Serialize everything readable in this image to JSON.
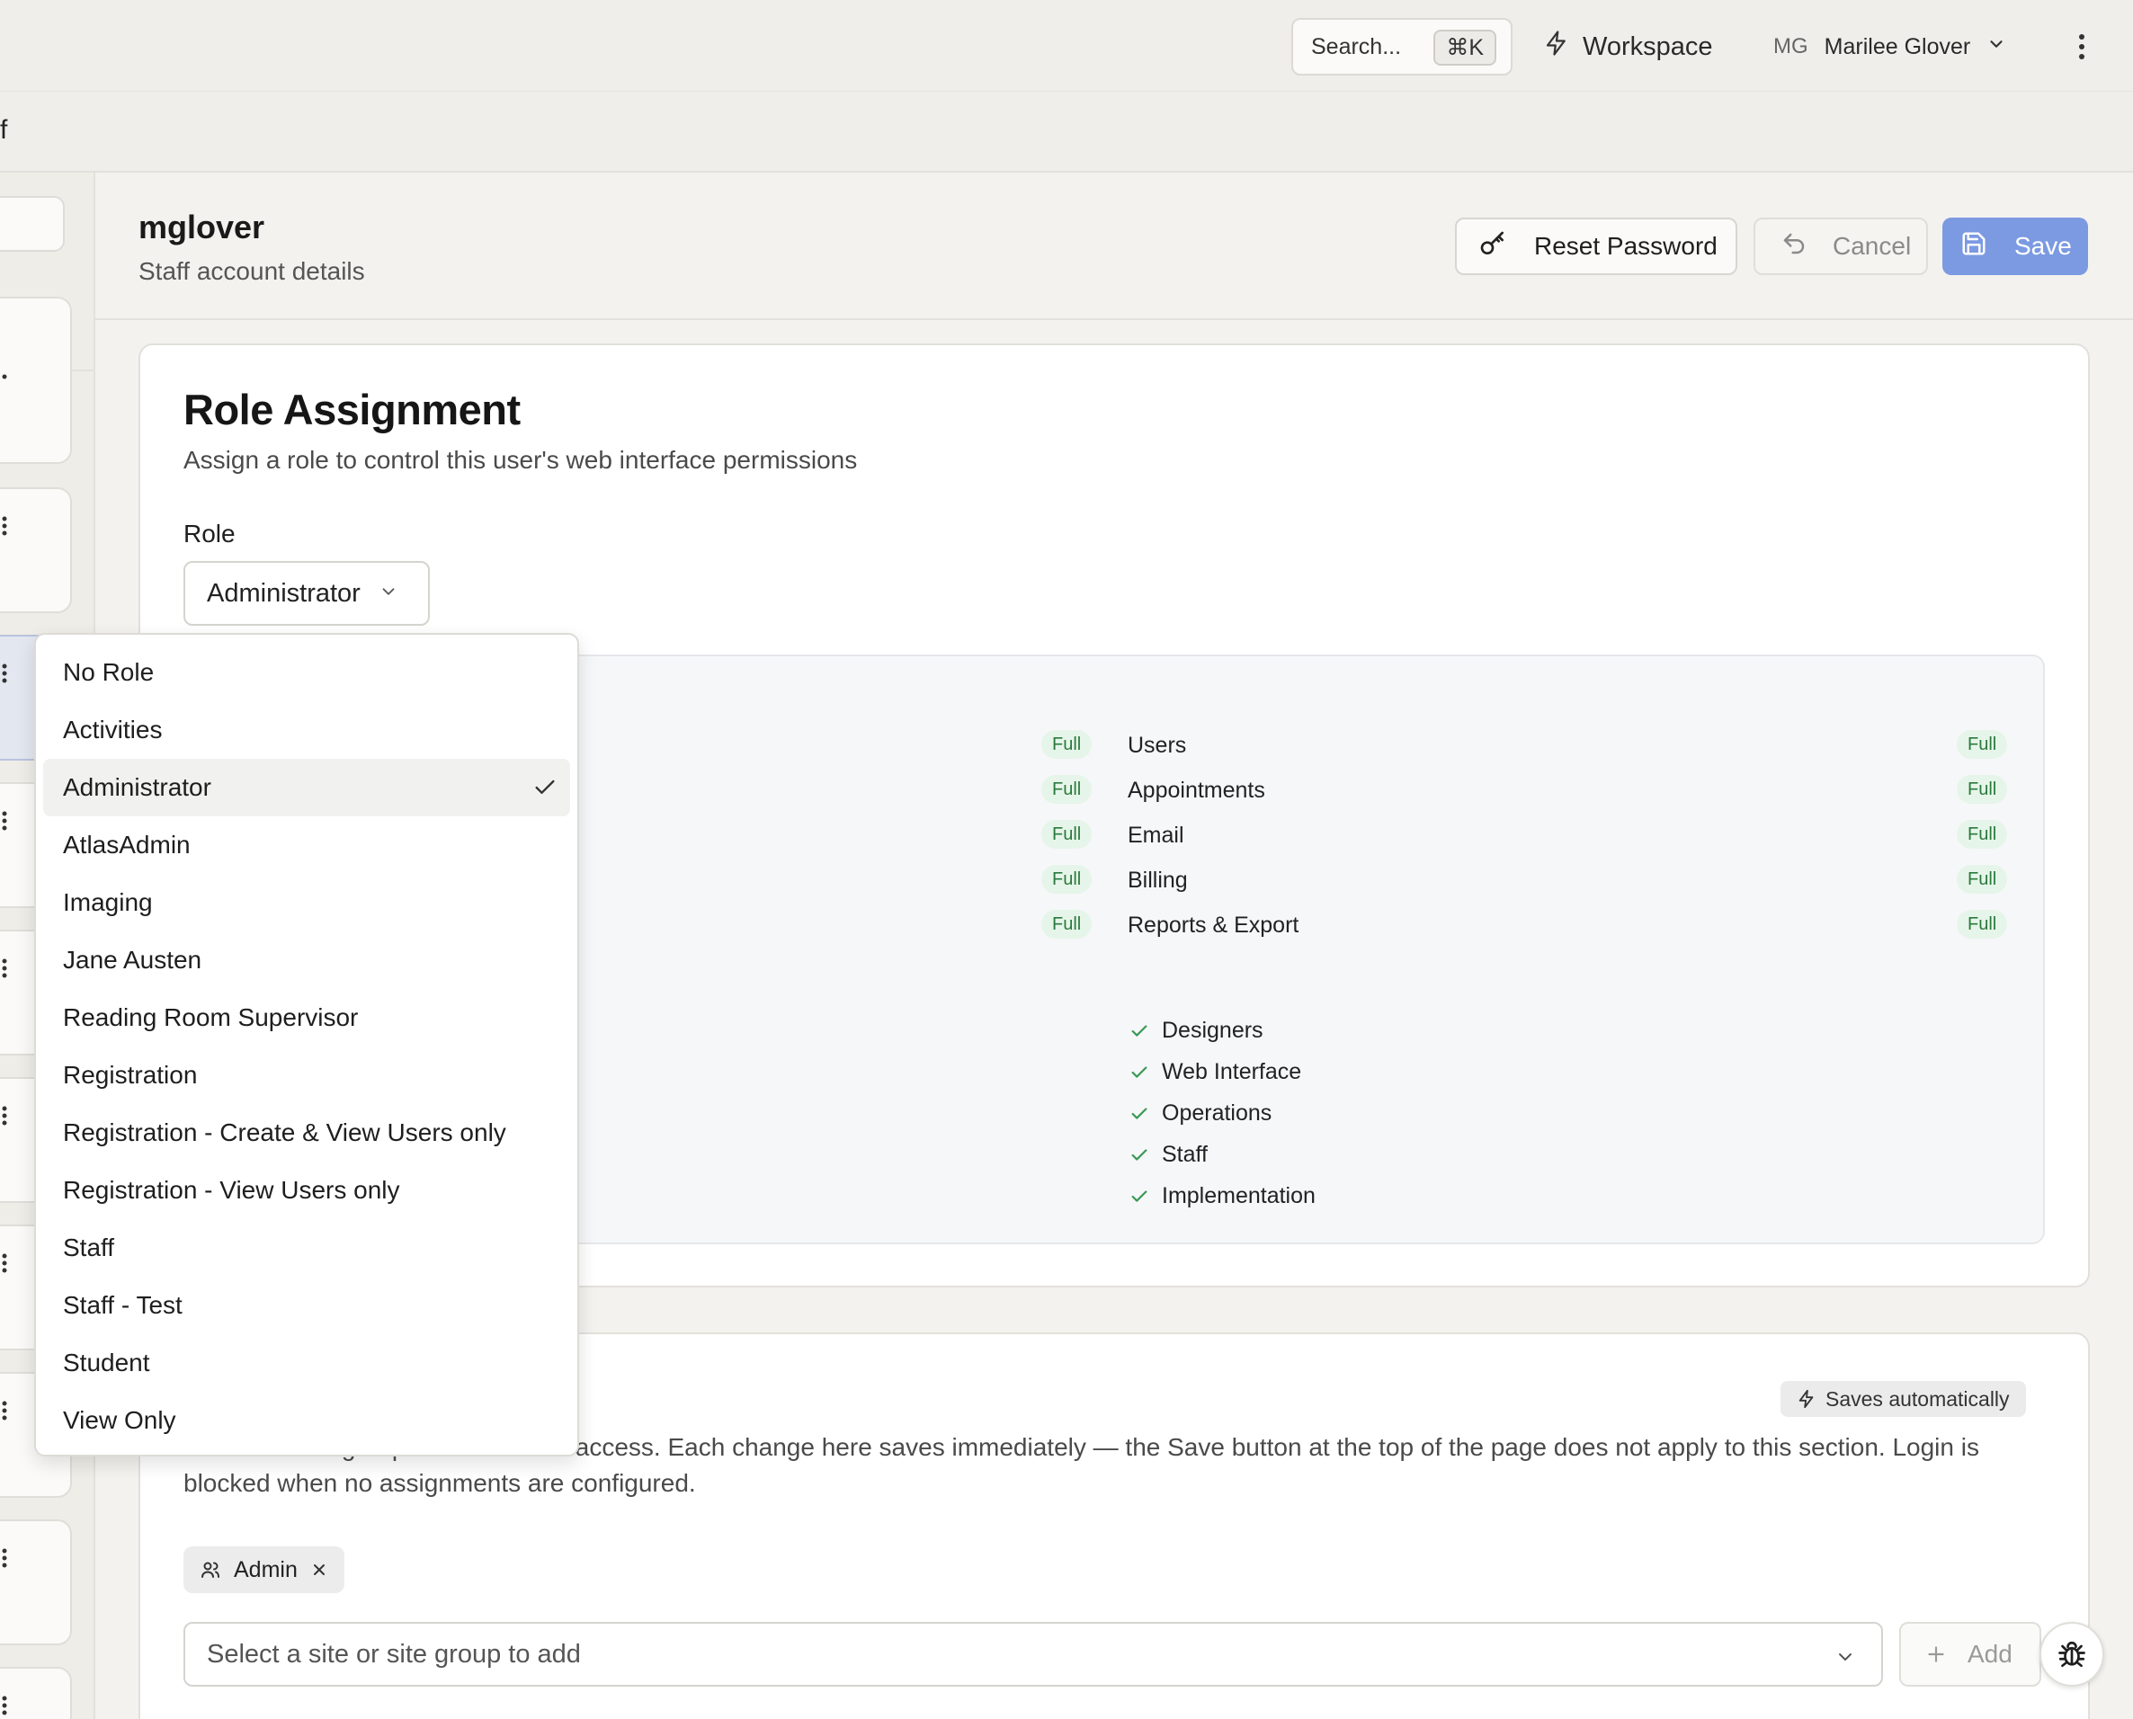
{
  "topbar": {
    "search_placeholder": "Search...",
    "search_shortcut": "⌘K",
    "workspace_label": "Workspace",
    "user_initials": "MG",
    "user_name": "Marilee Glover"
  },
  "subbar": {
    "text": "f"
  },
  "header": {
    "title": "mglover",
    "subtitle": "Staff account details",
    "reset_label": "Reset Password",
    "cancel_label": "Cancel",
    "save_label": "Save"
  },
  "role_card": {
    "title": "Role Assignment",
    "description": "Assign a role to control this user's web interface permissions",
    "role_label": "Role",
    "selected_role": "Administrator",
    "left_badges": [
      "Full",
      "Full",
      "Full",
      "Full",
      "Full"
    ],
    "permissions": [
      {
        "name": "Users",
        "level": "Full"
      },
      {
        "name": "Appointments",
        "level": "Full"
      },
      {
        "name": "Email",
        "level": "Full"
      },
      {
        "name": "Billing",
        "level": "Full"
      },
      {
        "name": "Reports & Export",
        "level": "Full"
      }
    ],
    "checks": [
      "Designers",
      "Web Interface",
      "Operations",
      "Staff",
      "Implementation"
    ]
  },
  "dropdown": {
    "options": [
      "No Role",
      "Activities",
      "Administrator",
      "AtlasAdmin",
      "Imaging",
      "Jane Austen",
      "Reading Room Supervisor",
      "Registration",
      "Registration - Create & View Users only",
      "Registration - View Users only",
      "Staff",
      "Staff - Test",
      "Student",
      "View Only"
    ],
    "selected_index": 2
  },
  "sites_card": {
    "saves_badge": "Saves automatically",
    "description": "Sites and site groups this user can access. Each change here saves immediately — the Save button at the top of the page does not apply to this section. Login is blocked when no assignments are configured.",
    "chip_label": "Admin",
    "select_placeholder": "Select a site or site group to add",
    "add_label": "Add"
  },
  "colors": {
    "primary": "#7c9ae2",
    "badge_bg": "#e6f5e9",
    "badge_text": "#2a7a3d",
    "check": "#3a9a55"
  },
  "icons": [
    "key-icon",
    "undo-icon",
    "save-icon",
    "lightning-icon",
    "chevron-down-icon",
    "kebab-icon",
    "check-icon",
    "users-icon",
    "close-icon",
    "plus-icon",
    "bug-icon"
  ]
}
